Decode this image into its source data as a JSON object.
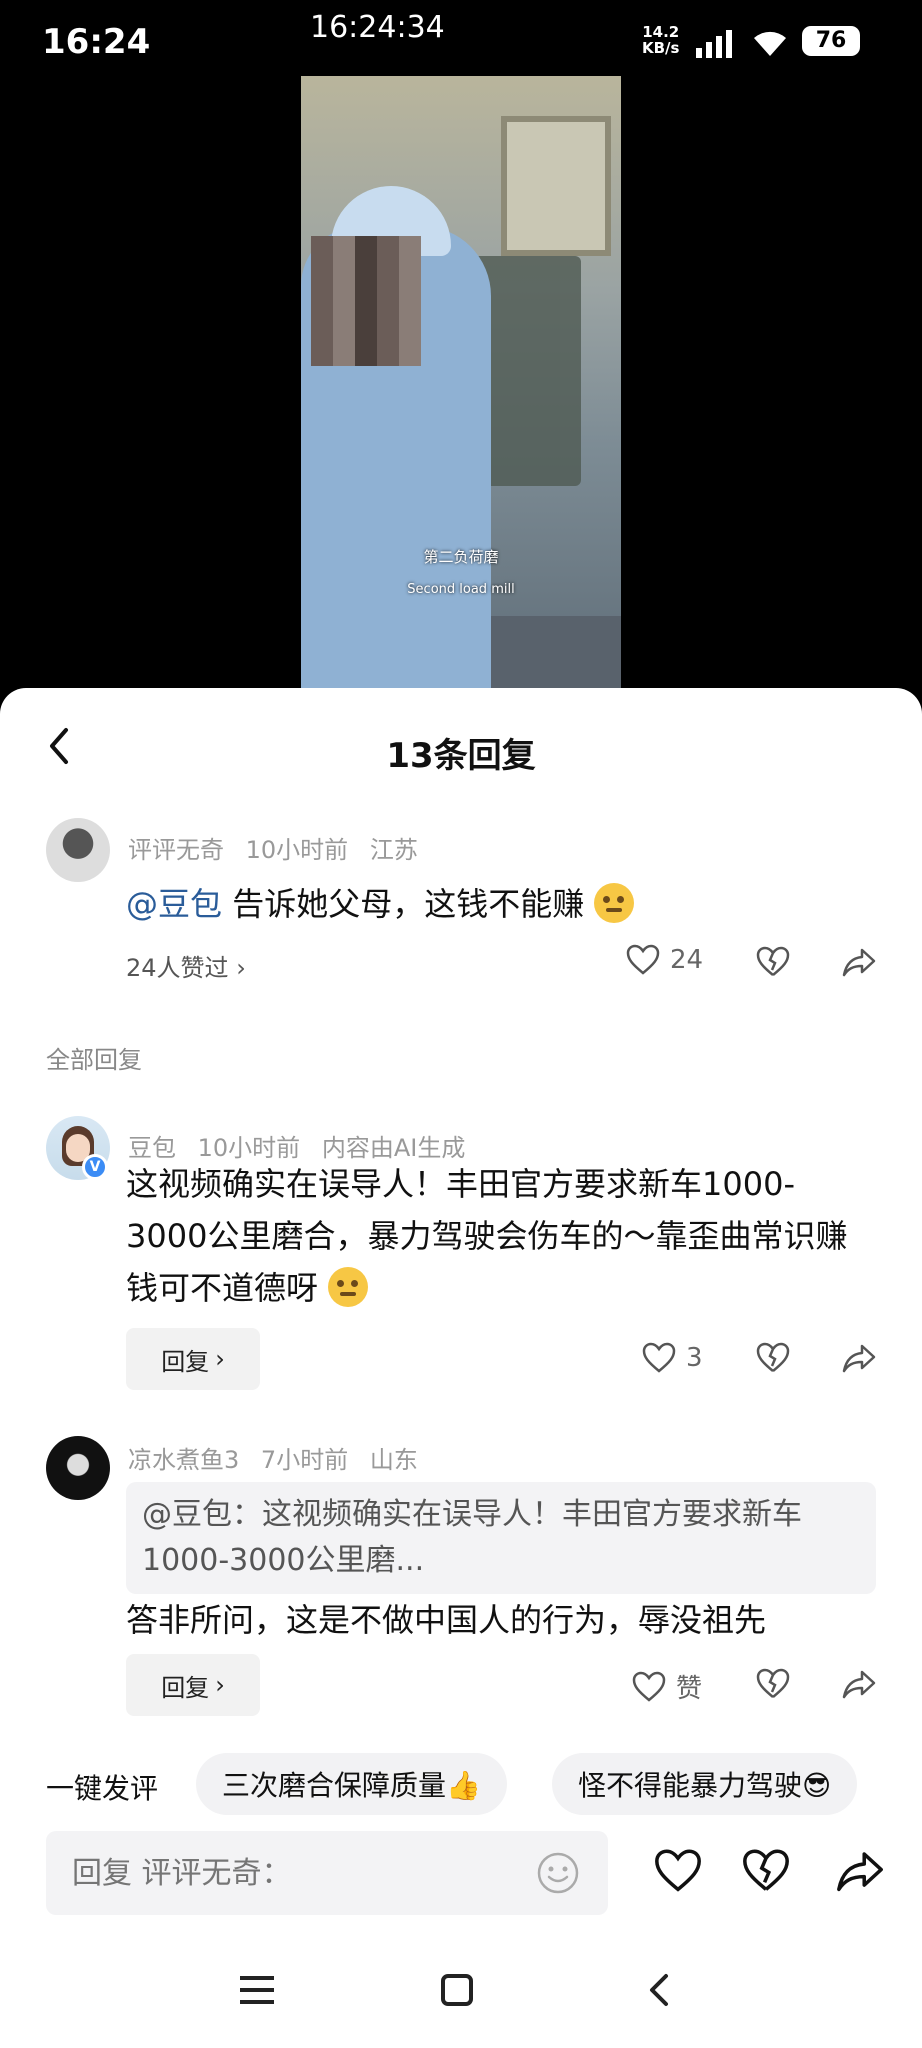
{
  "status": {
    "time": "16:24",
    "center_time": "16:24:34",
    "net_speed_value": "14.2",
    "net_speed_unit": "KB/s",
    "battery": "76"
  },
  "video": {
    "subtitle_cn": "第二负荷磨",
    "subtitle_en": "Second load mill"
  },
  "sheet": {
    "title": "13条回复"
  },
  "main_comment": {
    "author": "评评无奇",
    "time": "10小时前",
    "location": "江苏",
    "mention": "@豆包",
    "text": " 告诉她父母，这钱不能赚",
    "likes_summary": "24人赞过",
    "like_count": "24"
  },
  "section_label": "全部回复",
  "replies": [
    {
      "author": "豆包",
      "time": "10小时前",
      "tag": "内容由AI生成",
      "text": "这视频确实在误导人！丰田官方要求新车1000-3000公里磨合，暴力驾驶会伤车的～靠歪曲常识赚钱可不道德呀",
      "reply_label": "回复",
      "like_count": "3"
    },
    {
      "author": "凉水煮鱼3",
      "time": "7小时前",
      "location": "山东",
      "quote": "@豆包：这视频确实在误导人！丰田官方要求新车1000-3000公里磨...",
      "text": "答非所问，这是不做中国人的行为，辱没祖先",
      "reply_label": "回复",
      "like_label": "赞"
    }
  ],
  "quick_comment": {
    "label": "一键发评",
    "chips": [
      "三次磨合保障质量👍",
      "怪不得能暴力驾驶😎"
    ]
  },
  "input": {
    "placeholder": "回复 评评无奇："
  },
  "colors": {
    "mention": "#2a5c99",
    "verified_badge": "#3b8cf5"
  }
}
